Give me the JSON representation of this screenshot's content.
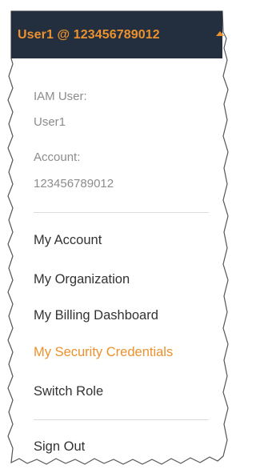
{
  "header": {
    "account_label": "User1 @ 123456789012",
    "caret_icon": "caret-up-icon"
  },
  "user_info": {
    "user_type_label": "IAM User:",
    "user_name": "User1",
    "account_label": "Account:",
    "account_id": "123456789012"
  },
  "menu": {
    "my_account": "My Account",
    "my_organization": "My Organization",
    "my_billing_dashboard": "My Billing Dashboard",
    "my_security_credentials": "My Security Credentials",
    "switch_role": "Switch Role",
    "sign_out": "Sign Out"
  },
  "colors": {
    "header_background": "#232f3e",
    "accent": "#ec912d",
    "menu_text": "#333333",
    "muted_text": "#8c8c8c",
    "divider": "#dcdcdc"
  }
}
